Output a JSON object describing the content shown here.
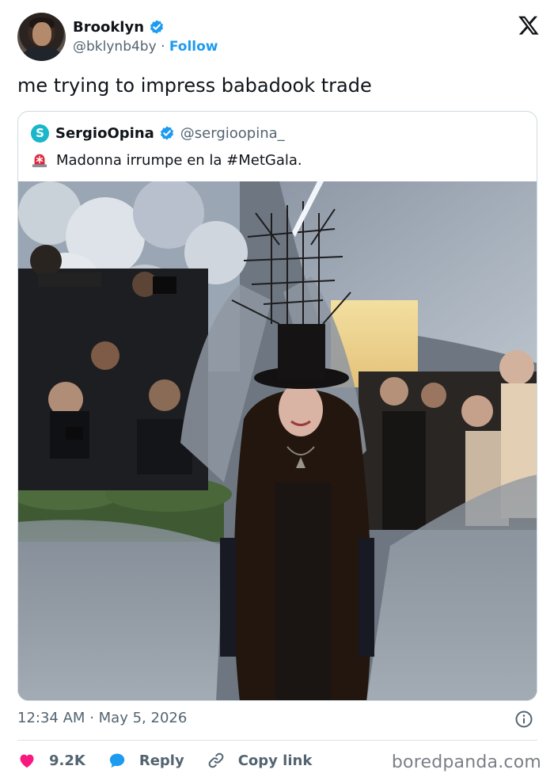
{
  "author": {
    "name": "Brooklyn",
    "handle": "@bklynb4by",
    "separator": "·",
    "follow_label": "Follow",
    "verified_color": "#1d9bf0"
  },
  "tweet": {
    "text": "me trying to impress babadook trade"
  },
  "quoted": {
    "avatar_letter": "S",
    "name": "SergioOpina",
    "handle": "@sergioopina_",
    "icon": "rotating-light-emoji",
    "text": "Madonna irrumpe en la #MetGala."
  },
  "meta": {
    "time": "12:34 AM",
    "separator": "·",
    "date": "May 5, 2026"
  },
  "actions": {
    "likes": "9.2K",
    "reply_label": "Reply",
    "copy_label": "Copy link",
    "like_color": "#f91880",
    "reply_color": "#1d9bf0"
  },
  "watermark": "boredpanda.com"
}
